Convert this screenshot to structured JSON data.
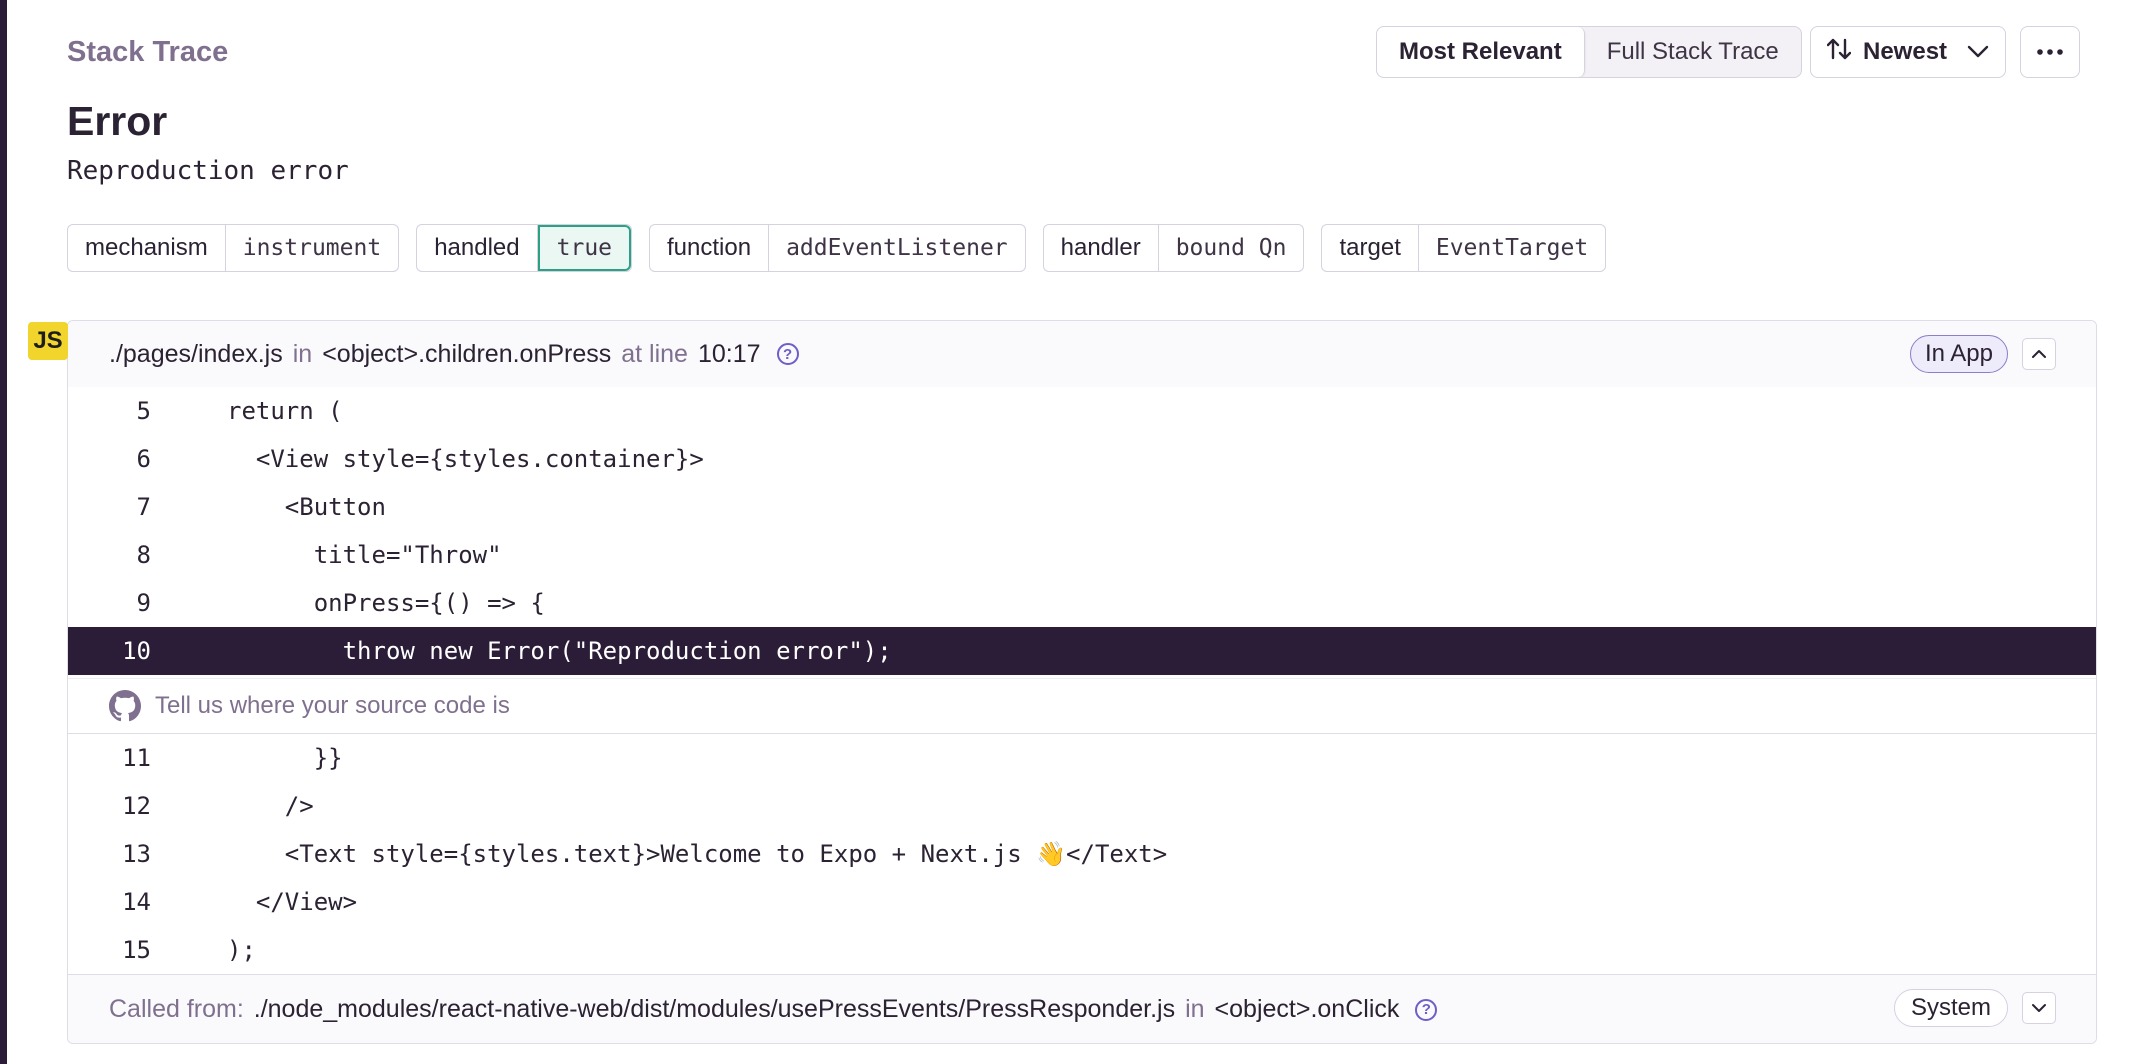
{
  "header": {
    "title": "Stack Trace",
    "view_toggle": {
      "options": [
        "Most Relevant",
        "Full Stack Trace"
      ],
      "selected": "Most Relevant"
    },
    "sort_label": "Newest"
  },
  "exception": {
    "type": "Error",
    "message": "Reproduction error"
  },
  "tags": [
    {
      "key": "mechanism",
      "value": "instrument"
    },
    {
      "key": "handled",
      "value": "true"
    },
    {
      "key": "function",
      "value": "addEventListener"
    },
    {
      "key": "handler",
      "value": "bound Qn"
    },
    {
      "key": "target",
      "value": "EventTarget"
    }
  ],
  "frame": {
    "platform_badge": "JS",
    "file": "./pages/index.js",
    "in_word": "in",
    "function": "<object>.children.onPress",
    "at_line_word": "at line",
    "location": "10:17",
    "in_app_label": "In App",
    "lines_before": [
      {
        "no": "5",
        "code": "return ("
      },
      {
        "no": "6",
        "code": "  <View style={styles.container}>"
      },
      {
        "no": "7",
        "code": "    <Button"
      },
      {
        "no": "8",
        "code": "      title=\"Throw\""
      },
      {
        "no": "9",
        "code": "      onPress={() => {"
      },
      {
        "no": "10",
        "code": "        throw new Error(\"Reproduction error\");"
      }
    ],
    "source_link_text": "Tell us where your source code is",
    "lines_after": [
      {
        "no": "11",
        "code": "      }}"
      },
      {
        "no": "12",
        "code": "    />"
      },
      {
        "no": "13",
        "code": "    <Text style={styles.text}>Welcome to Expo + Next.js 👋</Text>"
      },
      {
        "no": "14",
        "code": "  </View>"
      },
      {
        "no": "15",
        "code": ");"
      }
    ]
  },
  "called_from": {
    "label": "Called from:",
    "file": "./node_modules/react-native-web/dist/modules/usePressEvents/PressResponder.js",
    "in_word": "in",
    "function": "<object>.onClick",
    "system_label": "System"
  },
  "colors": {
    "active_line_bg": "#2b1d38",
    "in_app_border": "#8b7fc7",
    "handled_true_border": "#2ba185",
    "js_badge": "#f1d42c",
    "help_icon": "#6c5fc7"
  }
}
